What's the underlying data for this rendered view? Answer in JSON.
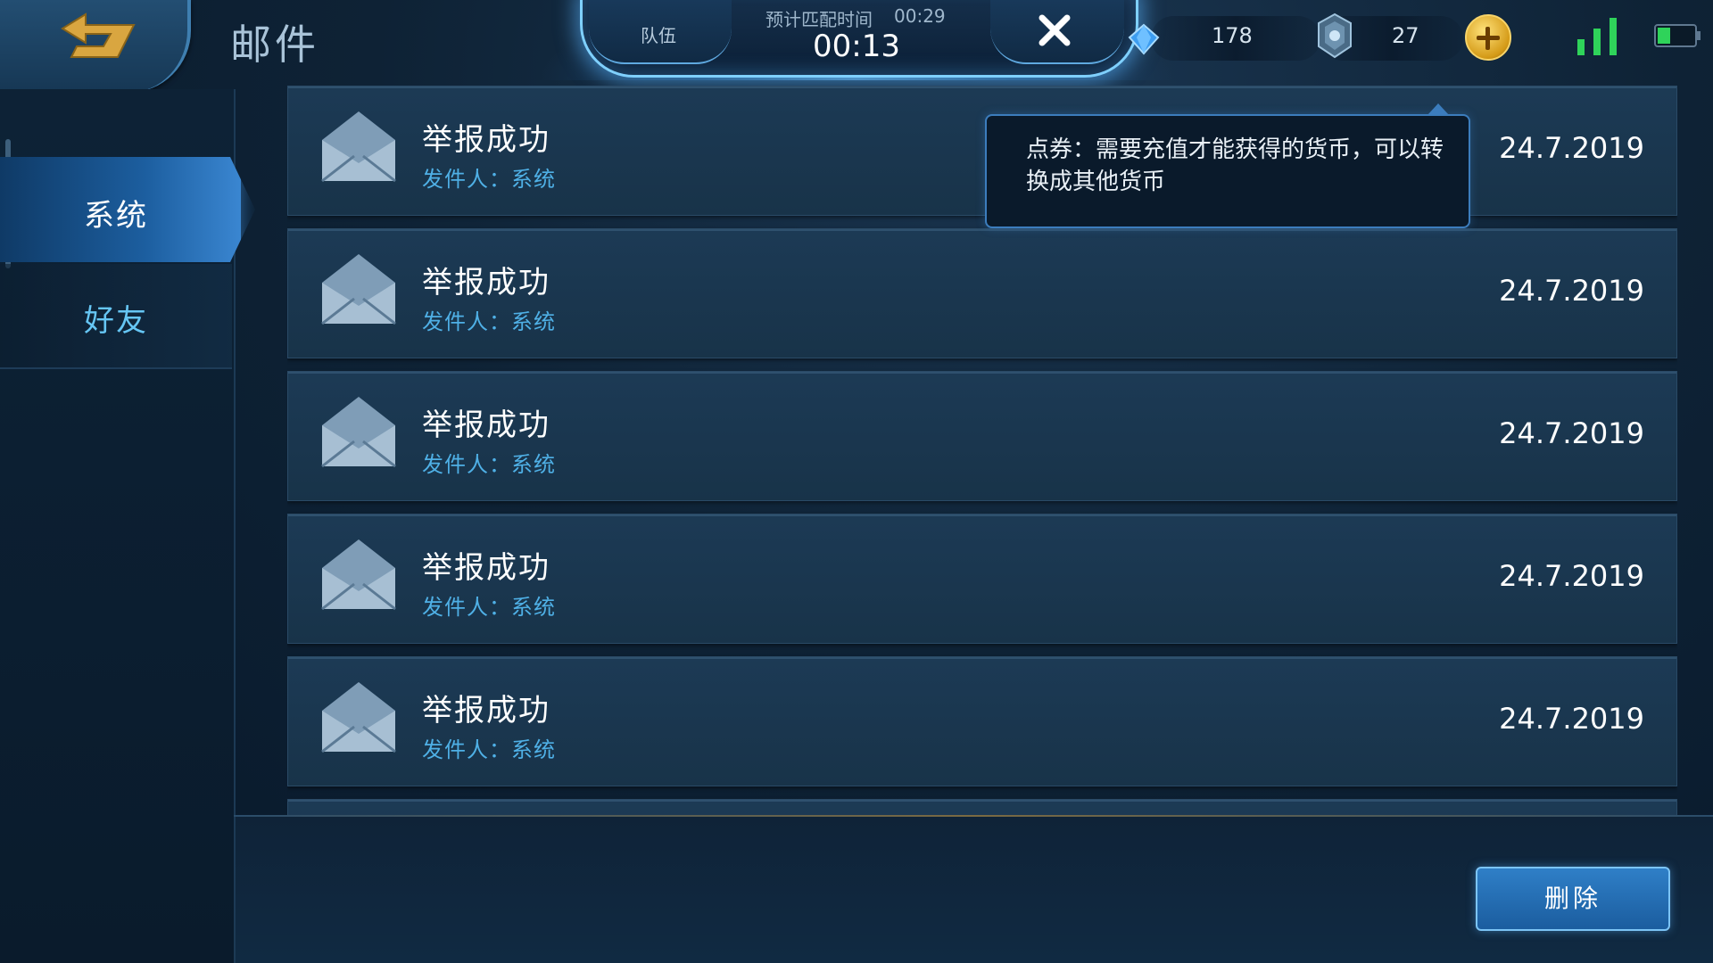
{
  "header": {
    "title": "邮件",
    "back_icon": "back-arrow-icon"
  },
  "match": {
    "team_label": "队伍",
    "expected_label": "预计匹配时间",
    "expected_time": "00:29",
    "elapsed_time": "00:13",
    "cancel_icon": "close-icon"
  },
  "currencies": [
    {
      "icon": "diamond-icon",
      "value": "178"
    },
    {
      "icon": "coupon-icon",
      "value": "27"
    }
  ],
  "status": {
    "signal_icon": "signal-icon",
    "battery_icon": "battery-icon"
  },
  "sidebar": {
    "tabs": [
      {
        "label": "系统",
        "active": true
      },
      {
        "label": "好友",
        "active": false
      }
    ]
  },
  "mails": [
    {
      "title": "举报成功",
      "sender": "发件人：系统",
      "date": "24.7.2019"
    },
    {
      "title": "举报成功",
      "sender": "发件人：系统",
      "date": "24.7.2019"
    },
    {
      "title": "举报成功",
      "sender": "发件人：系统",
      "date": "24.7.2019"
    },
    {
      "title": "举报成功",
      "sender": "发件人：系统",
      "date": "24.7.2019"
    },
    {
      "title": "举报成功",
      "sender": "发件人：系统",
      "date": "24.7.2019"
    }
  ],
  "tooltip": {
    "text": "点券：需要充值才能获得的货币，可以转换成其他货币"
  },
  "actions": {
    "delete_label": "删除"
  },
  "colors": {
    "accent": "#3a86d1",
    "sender_text": "#4fb0e6",
    "gold": "#d49a17",
    "signal": "#2fd35a"
  }
}
